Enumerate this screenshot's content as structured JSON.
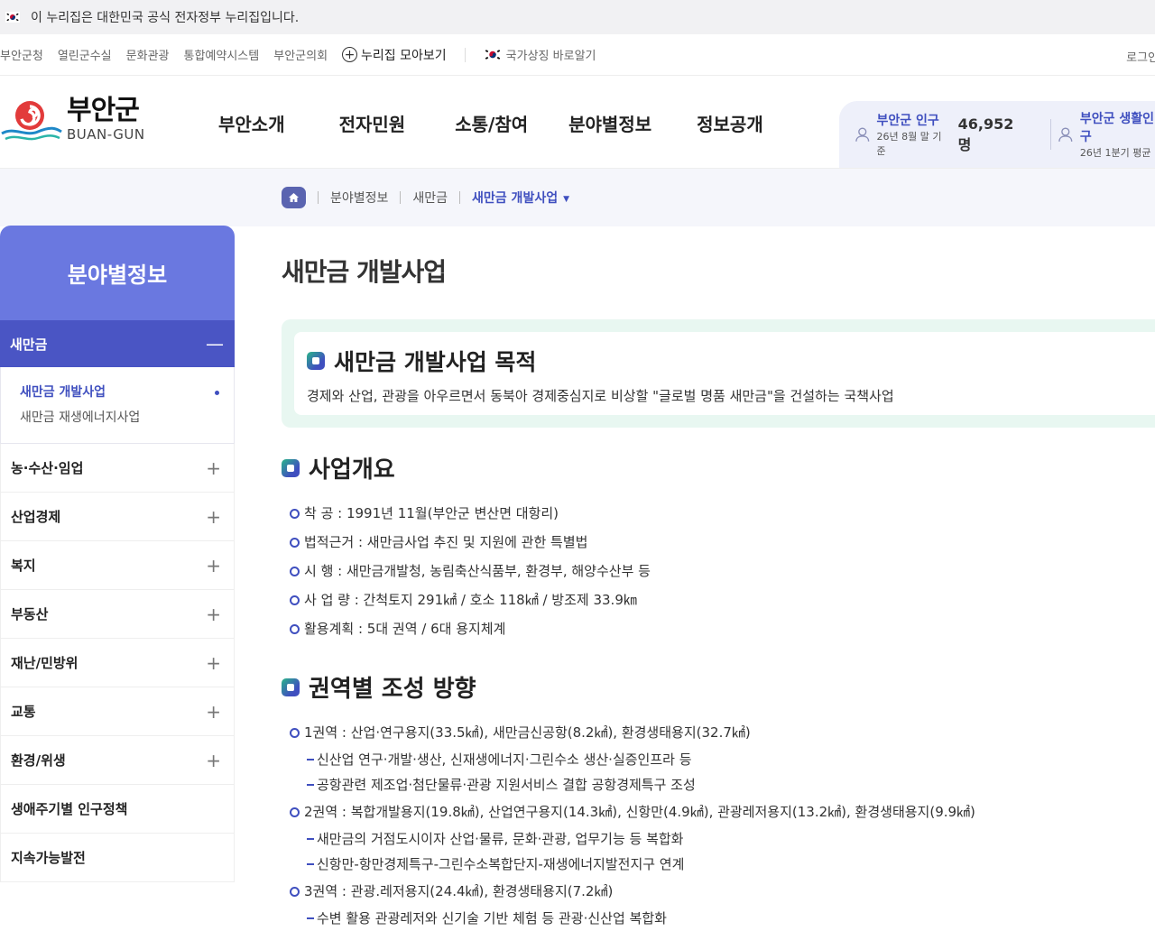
{
  "gov_banner": "이 누리집은 대한민국 공식 전자정부 누리집입니다.",
  "util_links": [
    "부안군청",
    "열린군수실",
    "문화관광",
    "통합예약시스템",
    "부안군의회"
  ],
  "nuri_link": "누리집 모아보기",
  "symbol_link": "국가상징 바로알기",
  "login": "로그인",
  "logo": {
    "ko": "부안군",
    "en": "BUAN-GUN"
  },
  "gnb": [
    "부안소개",
    "전자민원",
    "소통/참여",
    "분야별정보",
    "정보공개"
  ],
  "stats": [
    {
      "label": "부안군 인구",
      "sub": "26년 8월 말 기준",
      "value": "46,952명"
    },
    {
      "label": "부안군 생활인구",
      "sub": "26년 1분기 평균"
    }
  ],
  "breadcrumb": [
    "분야별정보",
    "새만금",
    "새만금 개발사업"
  ],
  "lnb": {
    "title": "분야별정보",
    "active": "새만금",
    "sub_items": [
      "새만금 개발사업",
      "새만금 재생에너지사업"
    ],
    "items": [
      "농·수산·임업",
      "산업경제",
      "복지",
      "부동산",
      "재난/민방위",
      "교통",
      "환경/위생",
      "생애주기별 인구정책",
      "지속가능발전"
    ]
  },
  "page_title": "새만금 개발사업",
  "purpose": {
    "title": "새만금 개발사업 목적",
    "desc": "경제와 산업, 관광을 아우르면서 동북아 경제중심지로 비상할 \"글로벌 명품 새만금\"을 건설하는 국책사업"
  },
  "overview": {
    "title": "사업개요",
    "items": [
      "착 공 : 1991년 11월(부안군 변산면 대항리)",
      "법적근거 : 새만금사업 추진 및 지원에 관한 특별법",
      "시 행 : 새만금개발청, 농림축산식품부, 환경부, 해양수산부 등",
      "사 업 량 : 간척토지 291㎢ / 호소 118㎢ / 방조제 33.9㎞",
      "활용계획 : 5대 권역 / 6대 용지체계"
    ]
  },
  "zones": {
    "title": "권역별 조성 방향",
    "z1": "1권역 : 산업·연구용지(33.5㎢), 새만금신공항(8.2㎢), 환경생태용지(32.7㎢)",
    "z1a": "신산업 연구·개발·생산, 신재생에너지·그린수소 생산·실증인프라 등",
    "z1b": "공항관련 제조업·첨단물류·관광 지원서비스 결합 공항경제특구 조성",
    "z2": "2권역 : 복합개발용지(19.8㎢), 산업연구용지(14.3㎢), 신항만(4.9㎢), 관광레저용지(13.2㎢), 환경생태용지(9.9㎢)",
    "z2a": "새만금의 거점도시이자 산업·물류, 문화·관광, 업무기능 등 복합화",
    "z2b": "신항만-항만경제특구-그린수소복합단지-재생에너지발전지구 연계",
    "z3": "3권역 : 관광.레저용지(24.4㎢), 환경생태용지(7.2㎢)",
    "z3a": "수변 활용 관광레저와 신기술 기반 체험 등 관광·신산업 복합화"
  },
  "colors": {
    "primary": "#3f4fbf",
    "lnb_head": "#6a78e0",
    "lnb_active": "#4a55c4",
    "purpose_bg": "#e8f7f1"
  }
}
